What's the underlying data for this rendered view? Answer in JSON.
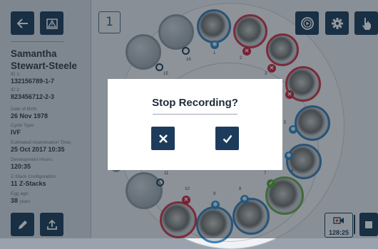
{
  "patient": {
    "name": "Samantha Stewart-Steele",
    "fields": [
      {
        "label": "ID 1:",
        "value": "132156789-1-7"
      },
      {
        "label": "ID 2:",
        "value": "823456712-2-3"
      },
      {
        "label": "Date of Birth:",
        "value": "26 Nov 1978"
      },
      {
        "label": "Cycle Type:",
        "value": "IVF"
      },
      {
        "label": "Estimated Insemination Time:",
        "value": "25 Oct 2017 10:35"
      },
      {
        "label": "Development Hours:",
        "value": "120:35"
      },
      {
        "label": "Z-Stack Configuration:",
        "value": "11 Z-Stacks"
      },
      {
        "label": "Egg age:",
        "value": "38",
        "unit": "years"
      }
    ]
  },
  "slot_number": "1",
  "wells": [
    {
      "n": "1"
    },
    {
      "n": "2"
    },
    {
      "n": "3"
    },
    {
      "n": "4"
    },
    {
      "n": "5"
    },
    {
      "n": "6"
    },
    {
      "n": "7"
    },
    {
      "n": "8"
    },
    {
      "n": "9"
    },
    {
      "n": "10"
    },
    {
      "n": "11"
    },
    {
      "n": "15"
    },
    {
      "n": "16"
    }
  ],
  "dialog": {
    "title": "Stop Recording?",
    "cancel_icon": "x-icon",
    "confirm_icon": "check-icon"
  },
  "recording": {
    "elapsed": "128:25"
  },
  "colors": {
    "primary": "#1d3c5c",
    "red": "#d0354a",
    "blue": "#3c7fb8",
    "green": "#6aa84f"
  },
  "icons": [
    "back-arrow-icon",
    "warning-icon",
    "play-icon",
    "gear-icon",
    "hand-pointer-icon",
    "pencil-icon",
    "upload-icon",
    "camera-icon",
    "stop-icon"
  ]
}
